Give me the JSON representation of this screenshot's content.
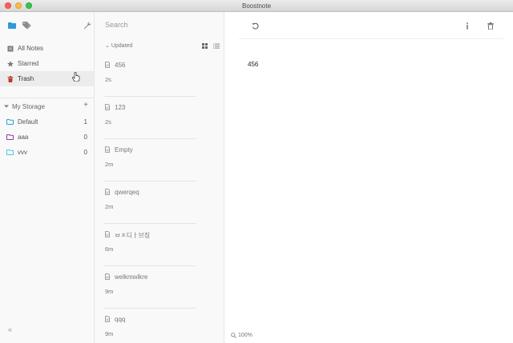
{
  "window": {
    "title": "Boostnote"
  },
  "sidebar": {
    "nav": [
      {
        "label": "All Notes",
        "icon": "notes-icon"
      },
      {
        "label": "Starred",
        "icon": "star-icon"
      },
      {
        "label": "Trash",
        "icon": "trash-icon",
        "active": true
      }
    ],
    "storage": {
      "name": "My Storage",
      "add_label": "+",
      "folders": [
        {
          "name": "Default",
          "count": "1",
          "color": "#2e9bd6"
        },
        {
          "name": "aaa",
          "count": "0",
          "color": "#8e3a9a"
        },
        {
          "name": "vvv",
          "count": "0",
          "color": "#4ec0e6"
        }
      ]
    },
    "collapse_label": "«"
  },
  "notelist": {
    "search_placeholder": "Search",
    "sort_label": "Updated",
    "notes": [
      {
        "title": "456",
        "time": "2s"
      },
      {
        "title": "123",
        "time": "2s"
      },
      {
        "title": "Empty",
        "time": "2m"
      },
      {
        "title": "qwerqeq",
        "time": "2m"
      },
      {
        "title": "ㅂㅈ디ㅏ브징",
        "time": "6m"
      },
      {
        "title": "welkmwlkre",
        "time": "9m"
      },
      {
        "title": "qqq",
        "time": "9m"
      }
    ]
  },
  "detail": {
    "content": "456",
    "zoom": "100%"
  },
  "colors": {
    "accent": "#2e9bd6",
    "trash": "#c0392b"
  }
}
